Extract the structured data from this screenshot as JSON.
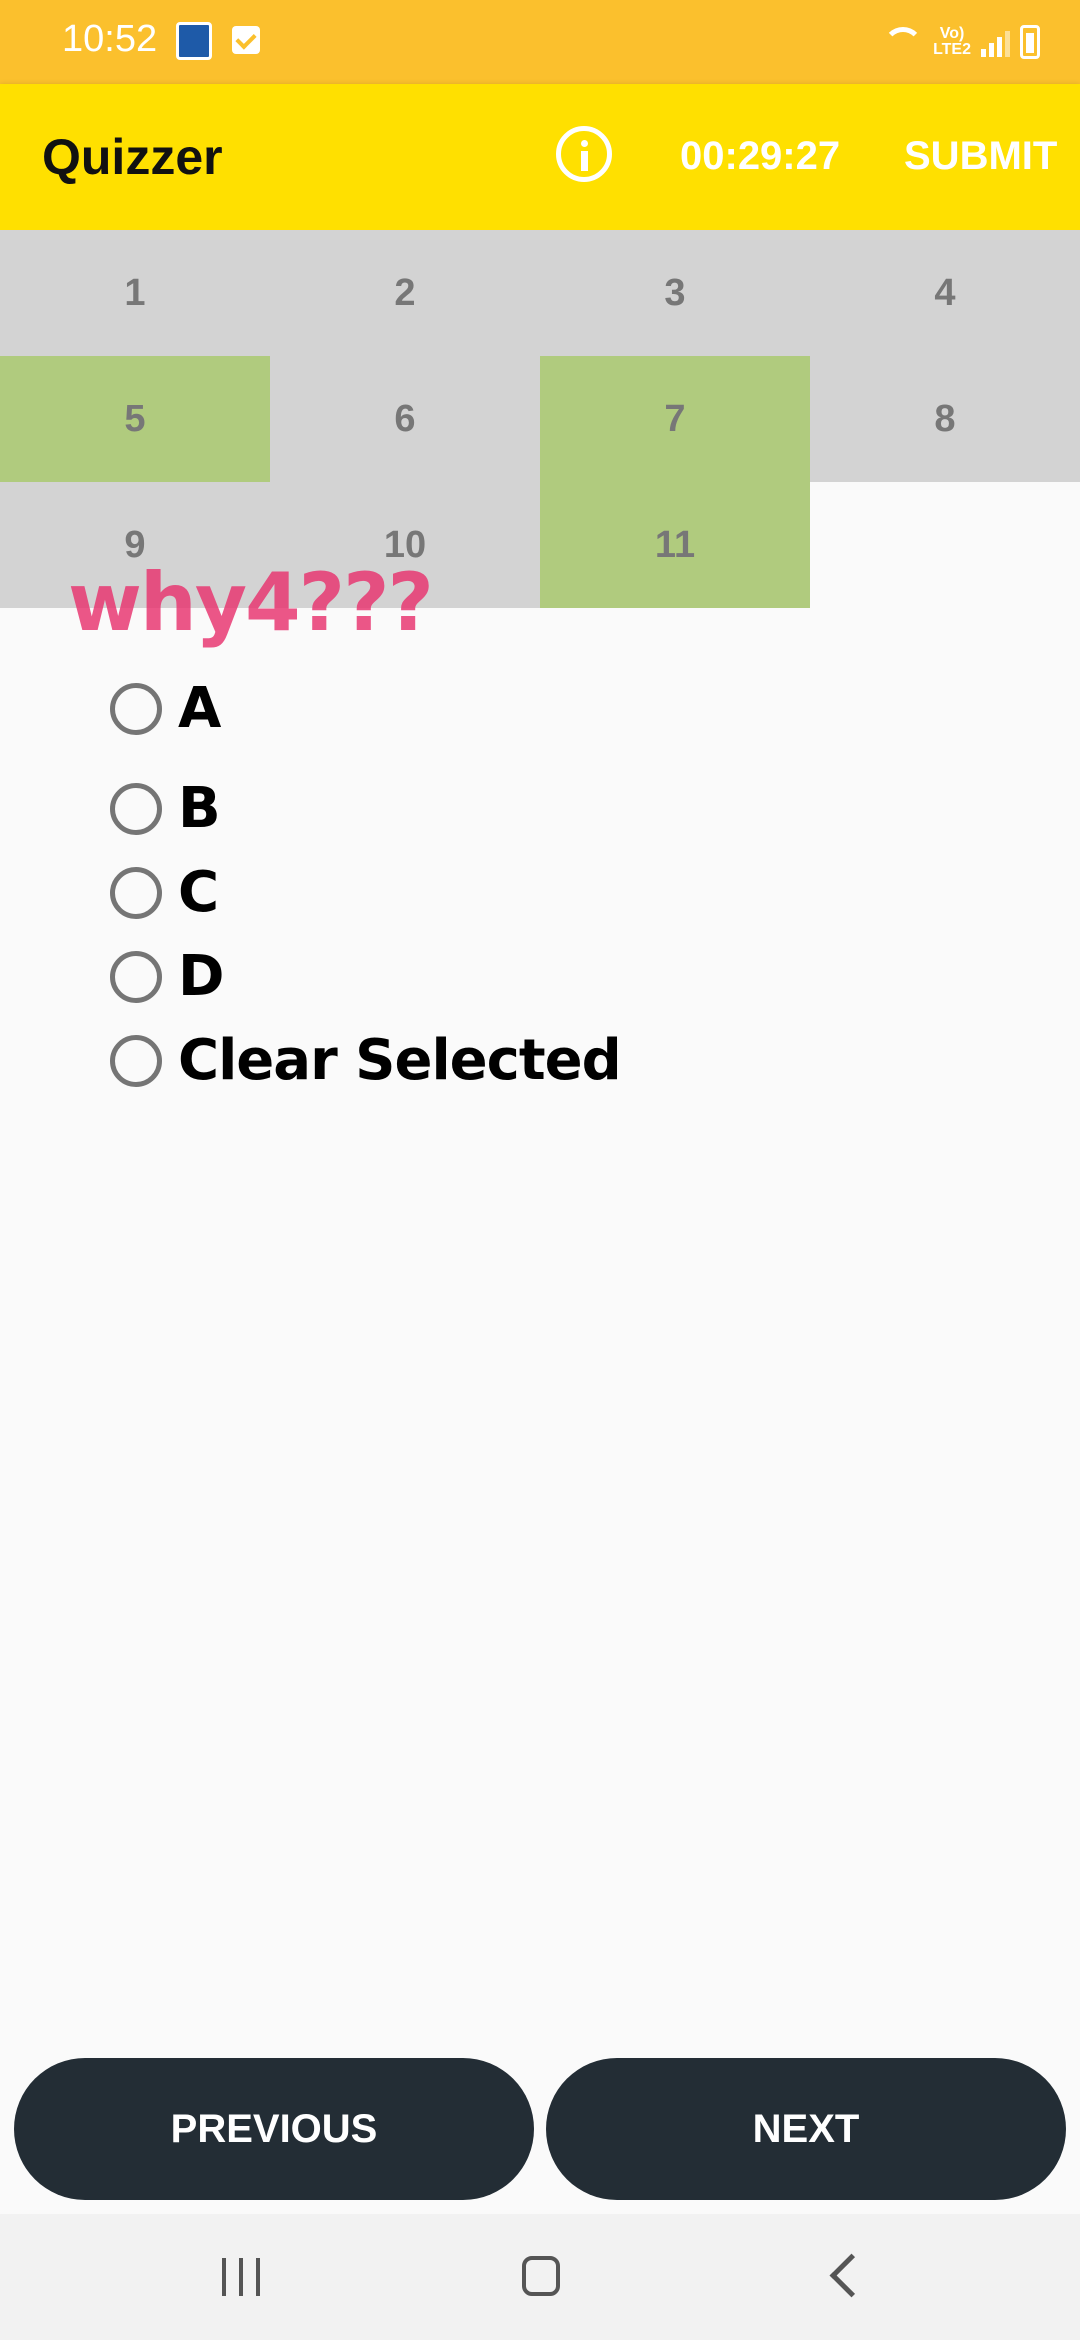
{
  "status_bar": {
    "time": "10:52",
    "network_label_top": "Vo)",
    "network_label_bottom": "LTE2"
  },
  "app_bar": {
    "title": "Quizzer",
    "timer": "00:29:27",
    "submit_label": "SUBMIT"
  },
  "colors": {
    "status_bar": "#fbc02d",
    "app_bar": "#ffe000",
    "cell_default": "#d3d3d3",
    "cell_answered": "#b0cb7e",
    "question_text": "#e8336f",
    "nav_button": "#232d35"
  },
  "question_grid": [
    {
      "label": "1",
      "answered": false
    },
    {
      "label": "2",
      "answered": false
    },
    {
      "label": "3",
      "answered": false
    },
    {
      "label": "4",
      "answered": false
    },
    {
      "label": "5",
      "answered": true
    },
    {
      "label": "6",
      "answered": false
    },
    {
      "label": "7",
      "answered": true
    },
    {
      "label": "8",
      "answered": false
    },
    {
      "label": "9",
      "answered": false
    },
    {
      "label": "10",
      "answered": false
    },
    {
      "label": "11",
      "answered": true
    }
  ],
  "question": {
    "text": "why4???",
    "options": [
      "A",
      "B",
      "C",
      "D",
      "Clear Selected"
    ]
  },
  "navigation": {
    "previous_label": "PREVIOUS",
    "next_label": "NEXT"
  }
}
